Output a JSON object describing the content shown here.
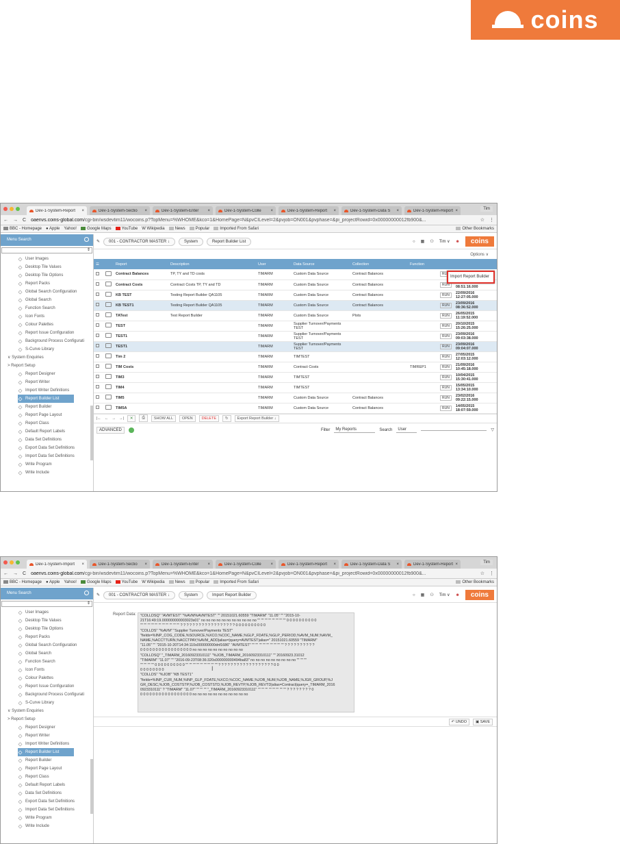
{
  "brand": {
    "name": "coins",
    "color": "#ef7a3b",
    "accent": "#6fa3cc"
  },
  "browser": {
    "tabs": [
      "Dev-1-System-Report",
      "Dev-1-System-Sectio",
      "Dev-1-System-Enter",
      "Dev-1-System-Colle",
      "Dev-1-System-Report",
      "Dev-1-System-Data S",
      "Dev-1-System-Report"
    ],
    "tabs2": [
      "Dev-1-System-Import",
      "Dev-1-System-Sectio",
      "Dev-1-System-Enter",
      "Dev-1-System-Colle",
      "Dev-1-System-Report",
      "Dev-1-System-Data S",
      "Dev-1-System-Report"
    ],
    "profile": "Tim",
    "url_host": "oaenvs.coins-global.com",
    "url_path": "/cgi-bin/wsdevtim11/wocoins.p?TopMenu=%WHOME&kco=1&HomePage=N&pvCILevel=2&pvjob=ON001&pvphase=&pi_projectRowid=0x00000000012fb900&...",
    "bookmarks": [
      "BBC - Homepage",
      "Apple",
      "Yahoo!",
      "Google Maps",
      "YouTube",
      "Wikipedia",
      "News",
      "Popular",
      "Imported From Safari"
    ],
    "other_bookmarks": "Other Bookmarks"
  },
  "sidebar": {
    "title": "Menu Search",
    "items": [
      "User Images",
      "Desktop Tile Values",
      "Desktop Tile Options",
      "Report Packs",
      "Global Search Configuration",
      "Global Search",
      "Function Search",
      "Icon Fonts",
      "Colour Palettes",
      "Report Issue Configuration",
      "Background Process Configurati",
      "S-Curve Library"
    ],
    "section1": "System Enquiries",
    "section2": "Report Setup",
    "items2": [
      "Report Designer",
      "Report Writer",
      "Import Writer Definitions",
      "Report Builder List",
      "Report Builder",
      "Report Page Layout",
      "Report Class",
      "Default Report Labels",
      "Data Set Definitions",
      "Export Data Set Definitions",
      "Import Data Set Definitions",
      "Write Program",
      "Write Include"
    ]
  },
  "header": {
    "crumbs": [
      "001 - CONTRACTOR MASTER",
      "System",
      "Report Builder List"
    ],
    "crumbs2": [
      "001 - CONTRACTOR MASTER",
      "System",
      "Import Report Builder"
    ],
    "user": "Tim",
    "logo": "coins"
  },
  "list": {
    "options": "Options",
    "columns": [
      "Report",
      "Description",
      "User",
      "Data Source",
      "Collection",
      "Function"
    ],
    "popup": "Import Report Builder",
    "run": "RUN",
    "rows": [
      [
        "Contract Balances",
        "TP, TY and TD costs",
        "TIMARM",
        "Custom Data Source",
        "Contract Balances",
        "",
        ""
      ],
      [
        "Contract Costs",
        "Contract Costs TP, TY and TD",
        "TIMARM",
        "Custom Data Source",
        "Contract Balances",
        "",
        "07/05/2015 08:51:16.000"
      ],
      [
        "KB TEST",
        "Testing Report Builder QA1105",
        "TIMARM",
        "Custom Data Source",
        "Contract Balances",
        "",
        "22/09/2016 12:27:05.000"
      ],
      [
        "KB TEST1",
        "Testing Report Builder QA1105",
        "TIMARM",
        "Custom Data Source",
        "Contract Balances",
        "",
        "23/09/2016 08:36:52.000"
      ],
      [
        "TATest",
        "Test Report Builder",
        "TIMARM",
        "Custom Data Source",
        "Plots",
        "",
        "26/05/2015 11:19:52.000"
      ],
      [
        "TEST",
        "",
        "TIMARM",
        "Supplier Turnover/Payments TEST",
        "",
        "",
        "20/10/2015 15:26:25.000"
      ],
      [
        "TEST1",
        "",
        "TIMARM",
        "Supplier Turnover/Payments TEST",
        "",
        "",
        "23/09/2016 09:03:38.000"
      ],
      [
        "TEST1",
        "",
        "TIMARM",
        "Supplier Turnover/Payments TEST",
        "",
        "",
        "23/09/2016 09:04:07.000"
      ],
      [
        "Tim 2",
        "",
        "TIMARM",
        "TIMTEST",
        "",
        "",
        "27/05/2015 12:03:12.000"
      ],
      [
        "TIM Costs",
        "",
        "TIMARM",
        "Contract Costs",
        "",
        "TIMREP1",
        "21/09/2016 10:45:18.000"
      ],
      [
        "TIM3",
        "",
        "TIMARM",
        "TIMTEST",
        "",
        "",
        "10/04/2015 15:30:41.000"
      ],
      [
        "TIM4",
        "",
        "TIMARM",
        "TIMTEST",
        "",
        "",
        "15/05/2015 13:34:10.000"
      ],
      [
        "TIM5",
        "",
        "TIMARM",
        "Custom Data Source",
        "Contract Balances",
        "",
        "23/02/2016 09:22:15.000"
      ],
      [
        "TIM5A",
        "",
        "TIMARM",
        "Custom Data Source",
        "Contract Balances",
        "",
        "14/05/2015 18:07:59.000"
      ]
    ],
    "highlighted": [
      3,
      7
    ],
    "toolbar": {
      "show_all": "SHOW ALL",
      "open": "OPEN",
      "delete": "DELETE",
      "export": "Export Report Builder"
    },
    "advanced": "ADVANCED",
    "filter_label": "Filter",
    "filter_value": "My Reports",
    "search_label": "Search",
    "search_value": "User"
  },
  "import": {
    "label": "Report Data:",
    "lines": [
      "\"COLLDSQ\" \"AVMTEST\" \"%AVM%AVMTEST\" \"\" 20151021.60559 \"TIMARM\" \"11.05\" \"\" \"2015-10-",
      "21T16:49:19.000000000003023s01\" no no no no no no no no no no no \"\" \"\" \"\" \"\" \"\" \"\" \"\" \"\" 0 0 0 0 0 0 0 0 0 0",
      "\"\" \"\" \"\" \"\" \"\" \"\" \"\" \"\" \"\" \"\" \"\" ? ? ? ? ? ? ? ? ? ? ? ? ? ? ? ? ? ? 0 0 0 0 0 0 0 0 0 0",
      "\"COLLDS\" \"%AVM\" \"Supplier Turnover/Payments TEST\"",
      "\"fields=%INP_COG_CODE,%SOURCE,%XCO,%COC_NAME,%GLP_FDATE,%GLP_PERIOD,%AVM_NUM,%AVM_",
      "NAME,%ACCTTURN,%ACCTPAY,%AVM_ADD|alias=|query=AVMTEST|alias=\" 20151021.60559 \"TIMARM\"",
      "\"11.05\" \"\" \"2015-10-20T14:34:110s000000000dnf1686\" \"AVMTEST\" \"\" \"\" \"\" \"\" \"\" \"\" \"\" \"\" \"\" ? ? ? ? ? ? ? ? ? ?",
      "0 0 0 0 0 0 0 0 0 0 0 0 0 0 0 0 0 no no no no no no no no no no",
      "\"COLLDSQ\" \"_TIMARM_20160923310111\" \"%JOB_TIMARM_20160923310111\" \"\" 20160923.31012",
      "\"TIMARM\" \"11.07\" \"\" \"2016-09-23T08:36:320s000000000494ba83\" no no no no no no no no no \"\" \"\" \"\"",
      "\"\" \"\" \"\" \"\" 0 0 0 0 0 0 0 0 0 0 \"\" \"\" \"\" \"\" \"\" \"\" \"\" \"\" \"\" ? ? ? ? ? ? ? ? ? ? ? ? ? ? ? ? ? ? 0 0",
      "0 0 0 0 0 0 0 0",
      "\"COLLDS\" \"%JOB\" \"KB TEST1\"",
      "\"fields=%INP_CUR_NUM,%INP_GLP_FDATE,%XCO,%COC_NAME,%JOB_NUM,%JOB_NAME,%JGR_GROUP,%J",
      "GR_DESC,%JOB_COSTSTP,%JOB_COSTSTD,%JOB_REVTP,%JOB_REVTD|alias=Contract|query=_TIMARM_2016",
      "0923310111\" ? \"TIMARM\" \"11.07\" \"\" \"\" \"\" \"_TIMARM_20160923310111\" \"\" \"\" \"\" \"\" \"\" \"\" \"\" \"\" ? ? ? ? ? ? ? ? 0",
      "0 0 0 0 0 0 0 0 0 0 0 0 0 0 0 0 0 no no no no no no no no no no no"
    ],
    "undo": "UNDO",
    "save": "SAVE"
  }
}
